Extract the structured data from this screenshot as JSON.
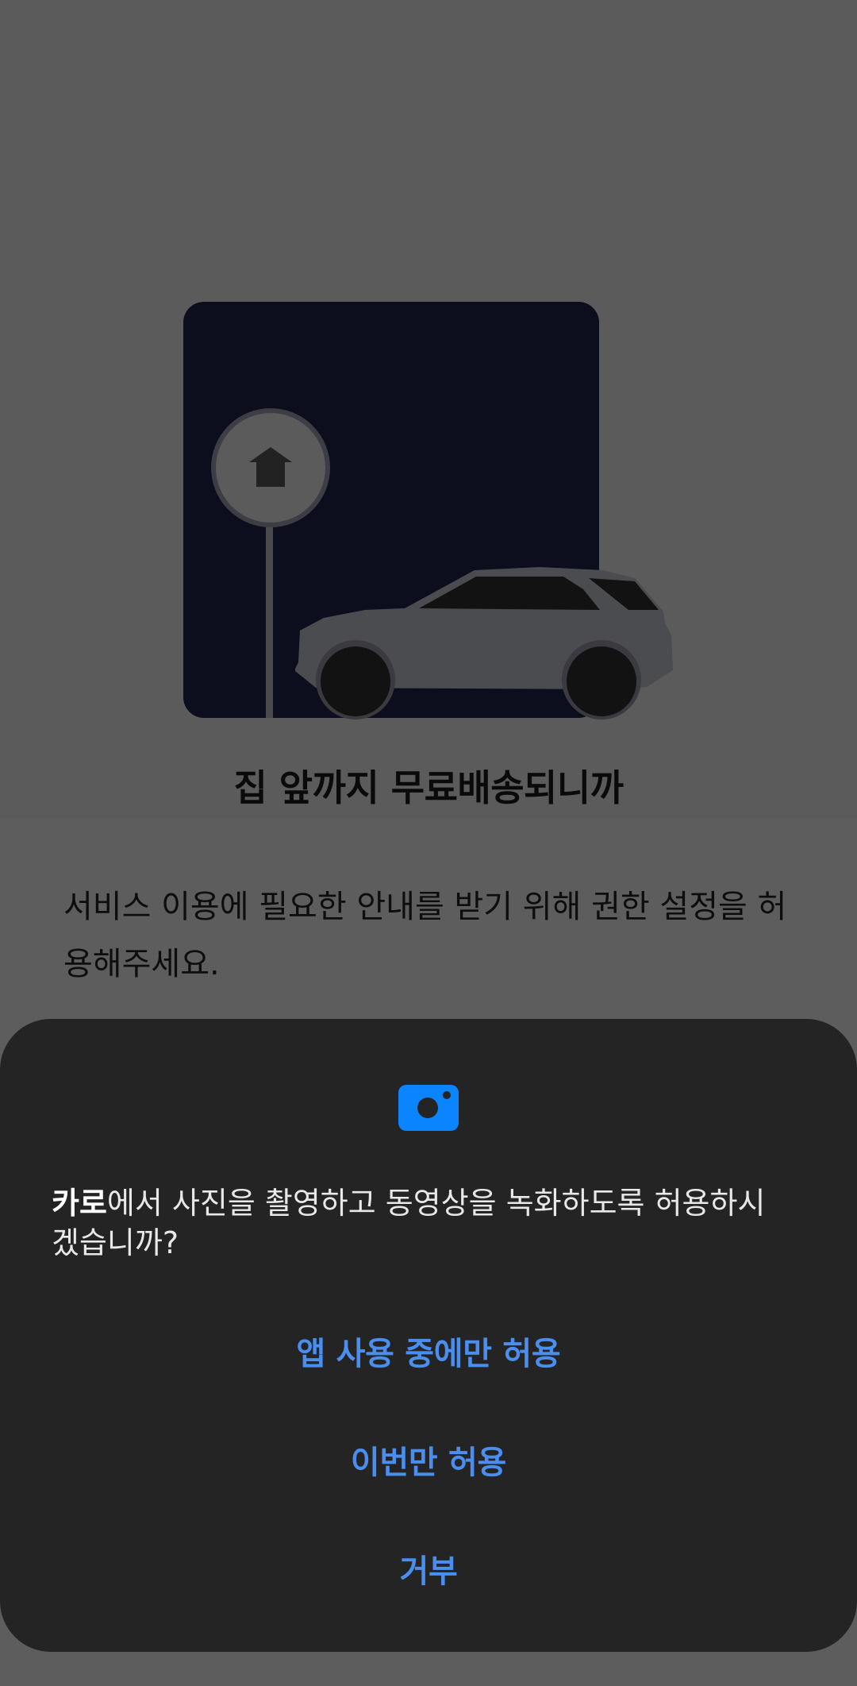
{
  "illustration": {
    "house_icon": "house-icon",
    "vehicle_icon": "car-icon"
  },
  "headline": "집 앞까지 무료배송되니까",
  "description": "서비스 이용에 필요한 안내를 받기 위해 권한 설정을 허용해주세요.",
  "permission_dialog": {
    "icon": "camera-icon",
    "app_name": "카로",
    "message": "에서 사진을 촬영하고 동영상을 녹화하도록 허용하시겠습니까?",
    "actions": {
      "allow_while_using": "앱 사용 중에만 허용",
      "allow_once": "이번만 허용",
      "deny": "거부"
    }
  },
  "colors": {
    "scrim": "#5b5b5b",
    "sheet": "#242424",
    "accent": "#4a8ff0",
    "camera_icon": "#0a84ff",
    "illustration_bg": "#0c0e1d"
  }
}
